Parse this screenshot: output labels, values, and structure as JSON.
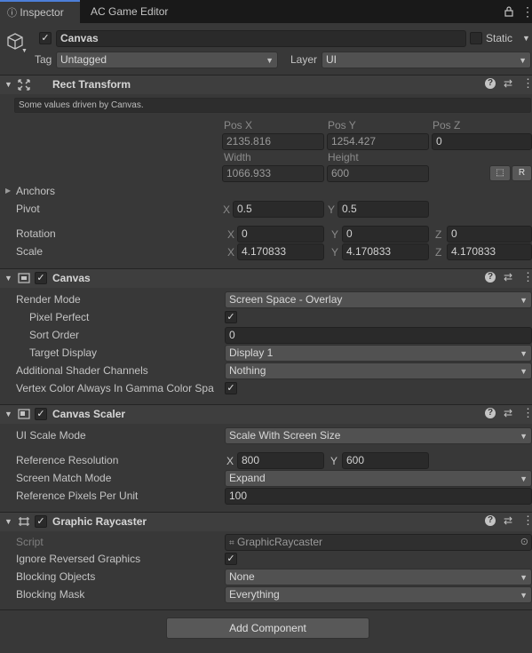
{
  "tabs": {
    "inspector": "Inspector",
    "ac_editor": "AC Game Editor"
  },
  "object": {
    "name": "Canvas",
    "static_label": "Static",
    "tag_label": "Tag",
    "tag_value": "Untagged",
    "layer_label": "Layer",
    "layer_value": "UI"
  },
  "rect_transform": {
    "title": "Rect Transform",
    "driven_note": "Some values driven by Canvas.",
    "pos_x_label": "Pos X",
    "pos_y_label": "Pos Y",
    "pos_z_label": "Pos Z",
    "pos_x": "2135.816",
    "pos_y": "1254.427",
    "pos_z": "0",
    "width_label": "Width",
    "height_label": "Height",
    "width": "1066.933",
    "height": "600",
    "r_button": "R",
    "anchors_label": "Anchors",
    "pivot_label": "Pivot",
    "pivot_x": "0.5",
    "pivot_y": "0.5",
    "rotation_label": "Rotation",
    "rot_x": "0",
    "rot_y": "0",
    "rot_z": "0",
    "scale_label": "Scale",
    "scale_x": "4.170833",
    "scale_y": "4.170833",
    "scale_z": "4.170833",
    "x": "X",
    "y": "Y",
    "z": "Z"
  },
  "canvas": {
    "title": "Canvas",
    "render_mode_label": "Render Mode",
    "render_mode": "Screen Space - Overlay",
    "pixel_perfect_label": "Pixel Perfect",
    "sort_order_label": "Sort Order",
    "sort_order": "0",
    "target_display_label": "Target Display",
    "target_display": "Display 1",
    "shader_channels_label": "Additional Shader Channels",
    "shader_channels": "Nothing",
    "vertex_color_label": "Vertex Color Always In Gamma Color Spa"
  },
  "canvas_scaler": {
    "title": "Canvas Scaler",
    "ui_scale_mode_label": "UI Scale Mode",
    "ui_scale_mode": "Scale With Screen Size",
    "ref_res_label": "Reference Resolution",
    "ref_x": "800",
    "ref_y": "600",
    "match_mode_label": "Screen Match Mode",
    "match_mode": "Expand",
    "ppu_label": "Reference Pixels Per Unit",
    "ppu": "100"
  },
  "raycaster": {
    "title": "Graphic Raycaster",
    "script_label": "Script",
    "script_value": "GraphicRaycaster",
    "ignore_reversed_label": "Ignore Reversed Graphics",
    "blocking_objects_label": "Blocking Objects",
    "blocking_objects": "None",
    "blocking_mask_label": "Blocking Mask",
    "blocking_mask": "Everything"
  },
  "add_component": "Add Component",
  "icons": {
    "info": "ⓘ",
    "lock": "lock-icon",
    "menu": "⋮",
    "help": "?",
    "check": "✓",
    "caret": "▼",
    "triangle_right": "▶",
    "triangle_down": "▼"
  },
  "colors": {
    "accent": "#4c7ed8",
    "panel": "#383838",
    "header": "#3e3e3e",
    "field": "#2a2a2a"
  }
}
